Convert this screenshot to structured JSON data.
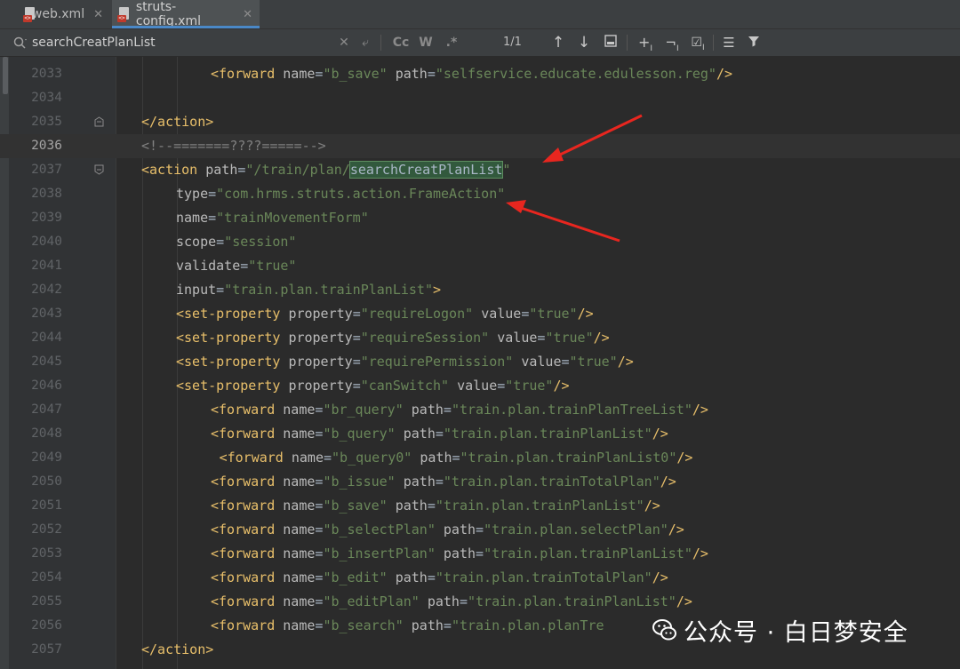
{
  "tabs": [
    {
      "label": "web.xml",
      "active": false
    },
    {
      "label": "struts-config.xml",
      "active": true
    }
  ],
  "search": {
    "query": "searchCreatPlanList",
    "match_count": "1/1",
    "case_label": "Cc",
    "word_label": "W",
    "regex_label": ".*"
  },
  "code_lines": [
    {
      "num": "2033",
      "indent": 2,
      "tokens": [
        [
          "tag",
          "<forward"
        ],
        [
          "txt",
          " "
        ],
        [
          "attr",
          "name"
        ],
        [
          "txt",
          "="
        ],
        [
          "val",
          "\"b_save\""
        ],
        [
          "txt",
          " "
        ],
        [
          "attr",
          "path"
        ],
        [
          "txt",
          "="
        ],
        [
          "val",
          "\"selfservice.educate.edulesson.reg\""
        ],
        [
          "tag",
          "/>"
        ]
      ]
    },
    {
      "num": "2034",
      "indent": 0,
      "tokens": []
    },
    {
      "num": "2035",
      "indent": 0,
      "fold": "end",
      "tokens": [
        [
          "tag",
          "</action>"
        ]
      ]
    },
    {
      "num": "2036",
      "indent": 0,
      "current": true,
      "tokens": [
        [
          "cmt",
          "<!--=======????=====-->"
        ]
      ]
    },
    {
      "num": "2037",
      "indent": 0,
      "fold": "start",
      "tokens": [
        [
          "tag",
          "<action"
        ],
        [
          "txt",
          " "
        ],
        [
          "attr",
          "path"
        ],
        [
          "txt",
          "="
        ],
        [
          "val",
          "\"/train/plan/"
        ],
        [
          "hl",
          "searchCreatPlanList"
        ],
        [
          "val",
          "\""
        ]
      ]
    },
    {
      "num": "2038",
      "indent": 1,
      "tokens": [
        [
          "attr",
          "type"
        ],
        [
          "txt",
          "="
        ],
        [
          "val",
          "\"com.hrms.struts.action.FrameAction\""
        ]
      ]
    },
    {
      "num": "2039",
      "indent": 1,
      "tokens": [
        [
          "attr",
          "name"
        ],
        [
          "txt",
          "="
        ],
        [
          "val",
          "\"trainMovementForm\""
        ]
      ]
    },
    {
      "num": "2040",
      "indent": 1,
      "tokens": [
        [
          "attr",
          "scope"
        ],
        [
          "txt",
          "="
        ],
        [
          "val",
          "\"session\""
        ]
      ]
    },
    {
      "num": "2041",
      "indent": 1,
      "tokens": [
        [
          "attr",
          "validate"
        ],
        [
          "txt",
          "="
        ],
        [
          "val",
          "\"true\""
        ]
      ]
    },
    {
      "num": "2042",
      "indent": 1,
      "tokens": [
        [
          "attr",
          "input"
        ],
        [
          "txt",
          "="
        ],
        [
          "val",
          "\"train.plan.trainPlanList\""
        ],
        [
          "tag",
          ">"
        ]
      ]
    },
    {
      "num": "2043",
      "indent": 1,
      "tokens": [
        [
          "tag",
          "<set-property"
        ],
        [
          "txt",
          " "
        ],
        [
          "attr",
          "property"
        ],
        [
          "txt",
          "="
        ],
        [
          "val",
          "\"requireLogon\""
        ],
        [
          "txt",
          " "
        ],
        [
          "attr",
          "value"
        ],
        [
          "txt",
          "="
        ],
        [
          "val",
          "\"true\""
        ],
        [
          "tag",
          "/>"
        ]
      ]
    },
    {
      "num": "2044",
      "indent": 1,
      "tokens": [
        [
          "tag",
          "<set-property"
        ],
        [
          "txt",
          " "
        ],
        [
          "attr",
          "property"
        ],
        [
          "txt",
          "="
        ],
        [
          "val",
          "\"requireSession\""
        ],
        [
          "txt",
          " "
        ],
        [
          "attr",
          "value"
        ],
        [
          "txt",
          "="
        ],
        [
          "val",
          "\"true\""
        ],
        [
          "tag",
          "/>"
        ]
      ]
    },
    {
      "num": "2045",
      "indent": 1,
      "tokens": [
        [
          "tag",
          "<set-property"
        ],
        [
          "txt",
          " "
        ],
        [
          "attr",
          "property"
        ],
        [
          "txt",
          "="
        ],
        [
          "val",
          "\"requirePermission\""
        ],
        [
          "txt",
          " "
        ],
        [
          "attr",
          "value"
        ],
        [
          "txt",
          "="
        ],
        [
          "val",
          "\"true\""
        ],
        [
          "tag",
          "/>"
        ]
      ]
    },
    {
      "num": "2046",
      "indent": 1,
      "tokens": [
        [
          "tag",
          "<set-property"
        ],
        [
          "txt",
          " "
        ],
        [
          "attr",
          "property"
        ],
        [
          "txt",
          "="
        ],
        [
          "val",
          "\"canSwitch\""
        ],
        [
          "txt",
          " "
        ],
        [
          "attr",
          "value"
        ],
        [
          "txt",
          "="
        ],
        [
          "val",
          "\"true\""
        ],
        [
          "tag",
          "/>"
        ]
      ]
    },
    {
      "num": "2047",
      "indent": 2,
      "tokens": [
        [
          "tag",
          "<forward"
        ],
        [
          "txt",
          " "
        ],
        [
          "attr",
          "name"
        ],
        [
          "txt",
          "="
        ],
        [
          "val",
          "\"br_query\""
        ],
        [
          "txt",
          " "
        ],
        [
          "attr",
          "path"
        ],
        [
          "txt",
          "="
        ],
        [
          "val",
          "\"train.plan.trainPlanTreeList\""
        ],
        [
          "tag",
          "/>"
        ]
      ]
    },
    {
      "num": "2048",
      "indent": 2,
      "tokens": [
        [
          "tag",
          "<forward"
        ],
        [
          "txt",
          " "
        ],
        [
          "attr",
          "name"
        ],
        [
          "txt",
          "="
        ],
        [
          "val",
          "\"b_query\""
        ],
        [
          "txt",
          " "
        ],
        [
          "attr",
          "path"
        ],
        [
          "txt",
          "="
        ],
        [
          "val",
          "\"train.plan.trainPlanList\""
        ],
        [
          "tag",
          "/>"
        ]
      ]
    },
    {
      "num": "2049",
      "indent": 2,
      "extra": 1,
      "tokens": [
        [
          "tag",
          "<forward"
        ],
        [
          "txt",
          " "
        ],
        [
          "attr",
          "name"
        ],
        [
          "txt",
          "="
        ],
        [
          "val",
          "\"b_query0\""
        ],
        [
          "txt",
          " "
        ],
        [
          "attr",
          "path"
        ],
        [
          "txt",
          "="
        ],
        [
          "val",
          "\"train.plan.trainPlanList0\""
        ],
        [
          "tag",
          "/>"
        ]
      ]
    },
    {
      "num": "2050",
      "indent": 2,
      "tokens": [
        [
          "tag",
          "<forward"
        ],
        [
          "txt",
          " "
        ],
        [
          "attr",
          "name"
        ],
        [
          "txt",
          "="
        ],
        [
          "val",
          "\"b_issue\""
        ],
        [
          "txt",
          " "
        ],
        [
          "attr",
          "path"
        ],
        [
          "txt",
          "="
        ],
        [
          "val",
          "\"train.plan.trainTotalPlan\""
        ],
        [
          "tag",
          "/>"
        ]
      ]
    },
    {
      "num": "2051",
      "indent": 2,
      "tokens": [
        [
          "tag",
          "<forward"
        ],
        [
          "txt",
          " "
        ],
        [
          "attr",
          "name"
        ],
        [
          "txt",
          "="
        ],
        [
          "val",
          "\"b_save\""
        ],
        [
          "txt",
          " "
        ],
        [
          "attr",
          "path"
        ],
        [
          "txt",
          "="
        ],
        [
          "val",
          "\"train.plan.trainPlanList\""
        ],
        [
          "tag",
          "/>"
        ]
      ]
    },
    {
      "num": "2052",
      "indent": 2,
      "tokens": [
        [
          "tag",
          "<forward"
        ],
        [
          "txt",
          " "
        ],
        [
          "attr",
          "name"
        ],
        [
          "txt",
          "="
        ],
        [
          "val",
          "\"b_selectPlan\""
        ],
        [
          "txt",
          " "
        ],
        [
          "attr",
          "path"
        ],
        [
          "txt",
          "="
        ],
        [
          "val",
          "\"train.plan.selectPlan\""
        ],
        [
          "tag",
          "/>"
        ]
      ]
    },
    {
      "num": "2053",
      "indent": 2,
      "tokens": [
        [
          "tag",
          "<forward"
        ],
        [
          "txt",
          " "
        ],
        [
          "attr",
          "name"
        ],
        [
          "txt",
          "="
        ],
        [
          "val",
          "\"b_insertPlan\""
        ],
        [
          "txt",
          " "
        ],
        [
          "attr",
          "path"
        ],
        [
          "txt",
          "="
        ],
        [
          "val",
          "\"train.plan.trainPlanList\""
        ],
        [
          "tag",
          "/>"
        ]
      ]
    },
    {
      "num": "2054",
      "indent": 2,
      "tokens": [
        [
          "tag",
          "<forward"
        ],
        [
          "txt",
          " "
        ],
        [
          "attr",
          "name"
        ],
        [
          "txt",
          "="
        ],
        [
          "val",
          "\"b_edit\""
        ],
        [
          "txt",
          " "
        ],
        [
          "attr",
          "path"
        ],
        [
          "txt",
          "="
        ],
        [
          "val",
          "\"train.plan.trainTotalPlan\""
        ],
        [
          "tag",
          "/>"
        ]
      ]
    },
    {
      "num": "2055",
      "indent": 2,
      "tokens": [
        [
          "tag",
          "<forward"
        ],
        [
          "txt",
          " "
        ],
        [
          "attr",
          "name"
        ],
        [
          "txt",
          "="
        ],
        [
          "val",
          "\"b_editPlan\""
        ],
        [
          "txt",
          " "
        ],
        [
          "attr",
          "path"
        ],
        [
          "txt",
          "="
        ],
        [
          "val",
          "\"train.plan.trainPlanList\""
        ],
        [
          "tag",
          "/>"
        ]
      ]
    },
    {
      "num": "2056",
      "indent": 2,
      "tokens": [
        [
          "tag",
          "<forward"
        ],
        [
          "txt",
          " "
        ],
        [
          "attr",
          "name"
        ],
        [
          "txt",
          "="
        ],
        [
          "val",
          "\"b_search\""
        ],
        [
          "txt",
          " "
        ],
        [
          "attr",
          "path"
        ],
        [
          "txt",
          "="
        ],
        [
          "val",
          "\"train.plan.planTre"
        ]
      ]
    },
    {
      "num": "2057",
      "indent": 0,
      "tokens": [
        [
          "tag",
          "</action>"
        ]
      ]
    }
  ],
  "watermark": {
    "text": "公众号 · 白日梦安全"
  },
  "colors": {
    "editor_bg": "#2b2b2b",
    "tag": "#e8bf6a",
    "attribute": "#bababa",
    "string": "#6a8759",
    "comment": "#808080",
    "search_highlight": "#32593d",
    "annotation_arrow": "#e8261f"
  }
}
